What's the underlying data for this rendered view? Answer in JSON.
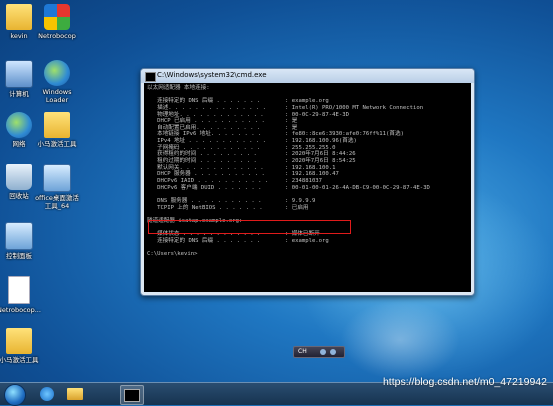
{
  "desktop": {
    "icons": [
      {
        "label": "kevin"
      },
      {
        "label": "Netrobocop"
      },
      {
        "label": "计算机"
      },
      {
        "label": "Windows Loader"
      },
      {
        "label": "网络"
      },
      {
        "label": "小马激活工具"
      },
      {
        "label": "回收站"
      },
      {
        "label": "office桌面激活工具_64"
      },
      {
        "label": "控制面板"
      },
      {
        "label": "Netrobocop..."
      },
      {
        "label": "小马激活工具"
      }
    ]
  },
  "cmd_window": {
    "title": "C:\\Windows\\system32\\cmd.exe",
    "lines": [
      {
        "k": "以太网适配器 本地连接:",
        "v": ""
      },
      {
        "k": "",
        "v": ""
      },
      {
        "k": "   连接特定的 DNS 后缀 . . . . . . .",
        "v": ": example.org"
      },
      {
        "k": "   描述. . . . . . . . . . . . . . .",
        "v": ": Intel(R) PRO/1000 MT Network Connection"
      },
      {
        "k": "   物理地址. . . . . . . . . . . . .",
        "v": ": 00-0C-29-87-4E-3D"
      },
      {
        "k": "   DHCP 已启用 . . . . . . . . . . .",
        "v": ": 是"
      },
      {
        "k": "   自动配置已启用. . . . . . . . . .",
        "v": ": 是"
      },
      {
        "k": "   本地链接 IPv6 地址. . . . . . . .",
        "v": ": fe80::8ce6:3930:afe0:76ff%11(首选)"
      },
      {
        "k": "   IPv4 地址 . . . . . . . . . . . .",
        "v": ": 192.168.100.96(首选)"
      },
      {
        "k": "   子网掩码 . . . . . . . . . . . .",
        "v": ": 255.255.255.0"
      },
      {
        "k": "   获得租约的时间 . . . . . . . . .",
        "v": ": 2020年7月6日 8:44:26"
      },
      {
        "k": "   租约过期的时间 . . . . . . . . .",
        "v": ": 2020年7月6日 8:54:25"
      },
      {
        "k": "   默认网关. . . . . . . . . . . . .",
        "v": ": 192.168.100.1"
      },
      {
        "k": "   DHCP 服务器 . . . . . . . . . . .",
        "v": ": 192.168.100.47"
      },
      {
        "k": "   DHCPv6 IAID . . . . . . . . . . .",
        "v": ": 234881037"
      },
      {
        "k": "   DHCPv6 客户端 DUID . . . . . . .",
        "v": ": 00-01-00-01-26-4A-DB-C9-00-0C-29-87-4E-3D"
      },
      {
        "k": "",
        "v": ""
      },
      {
        "k": "   DNS 服务器 . . . . . . . . . . .",
        "v": ": 9.9.9.9"
      },
      {
        "k": "   TCPIP 上的 NetBIOS . . . . . . .",
        "v": ": 已启用"
      },
      {
        "k": "",
        "v": ""
      },
      {
        "k": "隧道适配器 isatap.example.org:",
        "v": ""
      },
      {
        "k": "",
        "v": ""
      },
      {
        "k": "   媒体状态 . . . . . . . . . . . .",
        "v": ": 媒体已断开"
      },
      {
        "k": "   连接特定的 DNS 后缀 . . . . . . .",
        "v": ": example.org"
      },
      {
        "k": "",
        "v": ""
      },
      {
        "k": "C:\\Users\\kevin>",
        "v": ""
      }
    ]
  },
  "tray_widget": {
    "lang": "CH"
  },
  "watermark": "https://blog.csdn.net/m0_47219942"
}
